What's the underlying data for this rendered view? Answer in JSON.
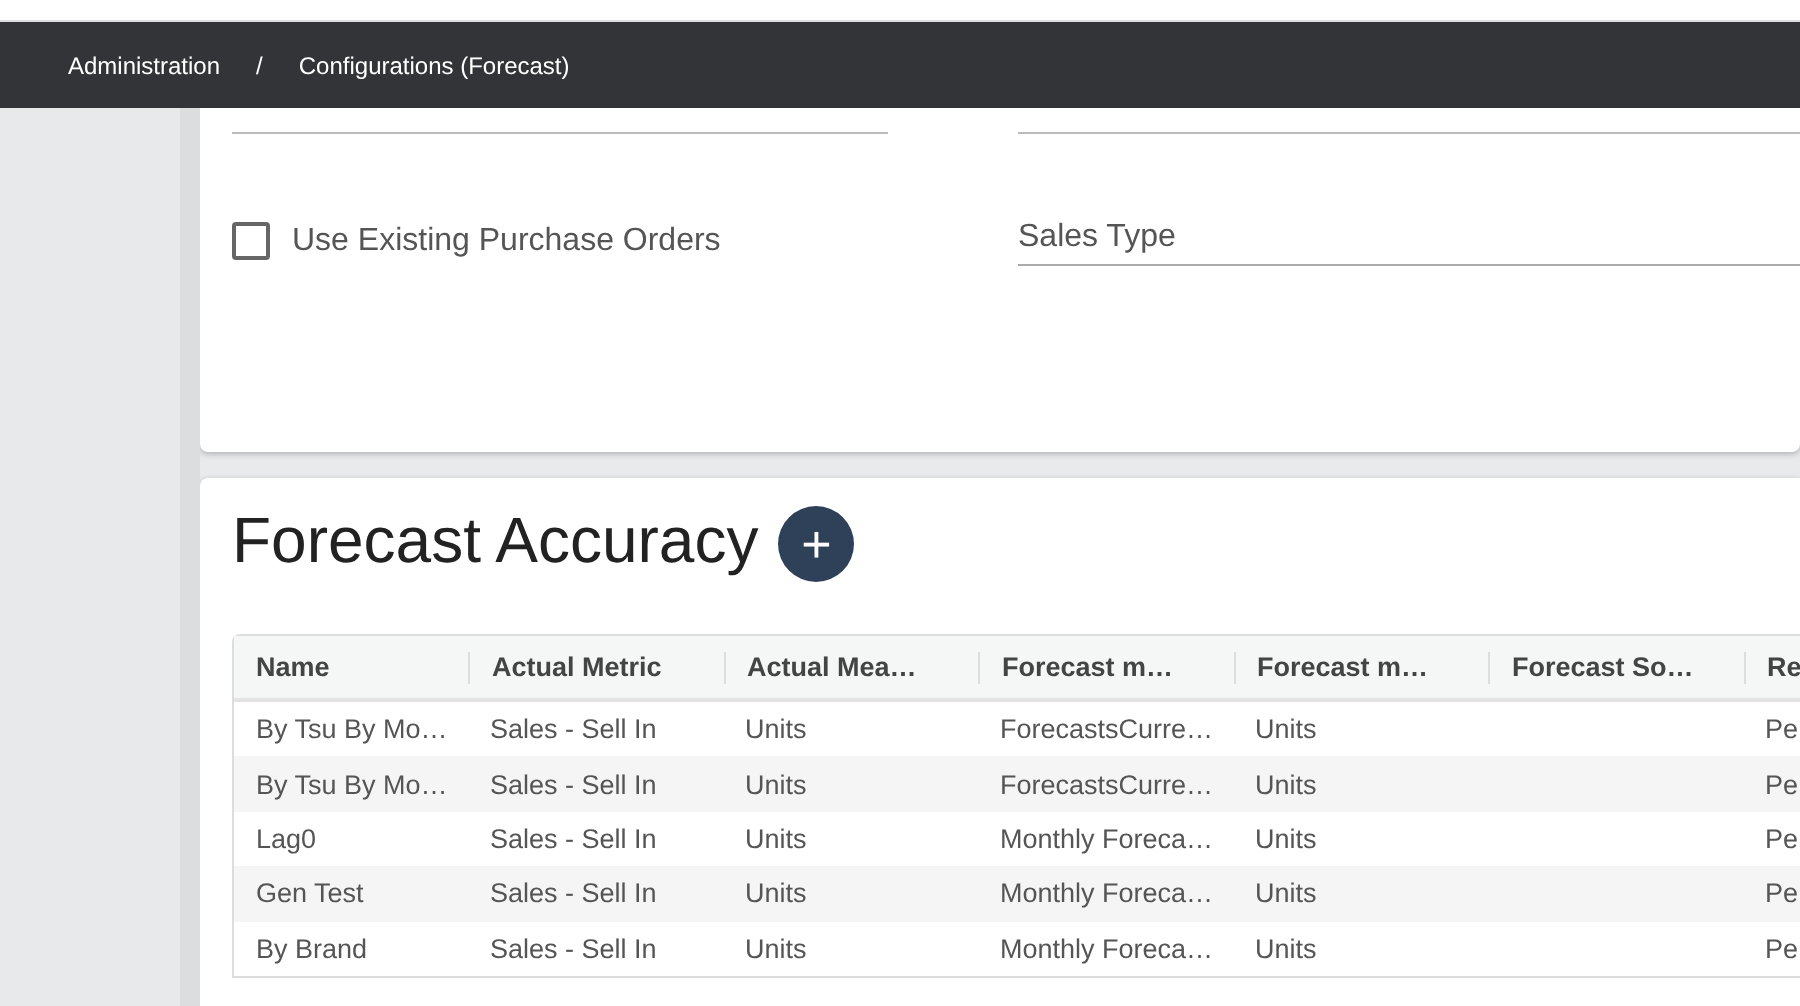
{
  "breadcrumb": [
    {
      "label": "Administration"
    },
    {
      "label": "/"
    },
    {
      "label": "Configurations (Forecast)"
    }
  ],
  "settings": {
    "checkbox": {
      "label": "Use Existing Purchase Orders",
      "checked": false
    },
    "sales_type": {
      "placeholder": "Sales Type"
    }
  },
  "forecast_accuracy": {
    "title": "Forecast Accuracy",
    "add_button": "+",
    "table": {
      "columns": [
        "Name",
        "Actual Metric",
        "Actual Mea…",
        "Forecast m…",
        "Forecast m…",
        "Forecast So…",
        "Re"
      ],
      "rows": [
        {
          "column_1": "By Tsu By Mo…",
          "column_2": "Sales - Sell In",
          "column_3": "Units",
          "column_4": "ForecastsCurre…",
          "column_5": "Units",
          "column_7": "Pe"
        },
        {
          "column_1": "By Tsu By Mo…",
          "column_2": "Sales - Sell In",
          "column_3": "Units",
          "column_4": "ForecastsCurre…",
          "column_5": "Units",
          "column_7": "Pe"
        },
        {
          "column_1": "Lag0",
          "column_2": "Sales - Sell In",
          "column_3": "Units",
          "column_4": "Monthly Foreca…",
          "column_5": "Units",
          "column_7": "Pe"
        },
        {
          "column_1": "Gen Test",
          "column_2": "Sales - Sell In",
          "column_3": "Units",
          "column_4": "Monthly Foreca…",
          "column_5": "Units",
          "column_7": "Pe"
        },
        {
          "column_1": "By Brand",
          "column_2": "Sales - Sell In",
          "column_3": "Units",
          "column_4": "Monthly Foreca…",
          "column_5": "Units",
          "column_7": "Pe"
        }
      ]
    }
  }
}
